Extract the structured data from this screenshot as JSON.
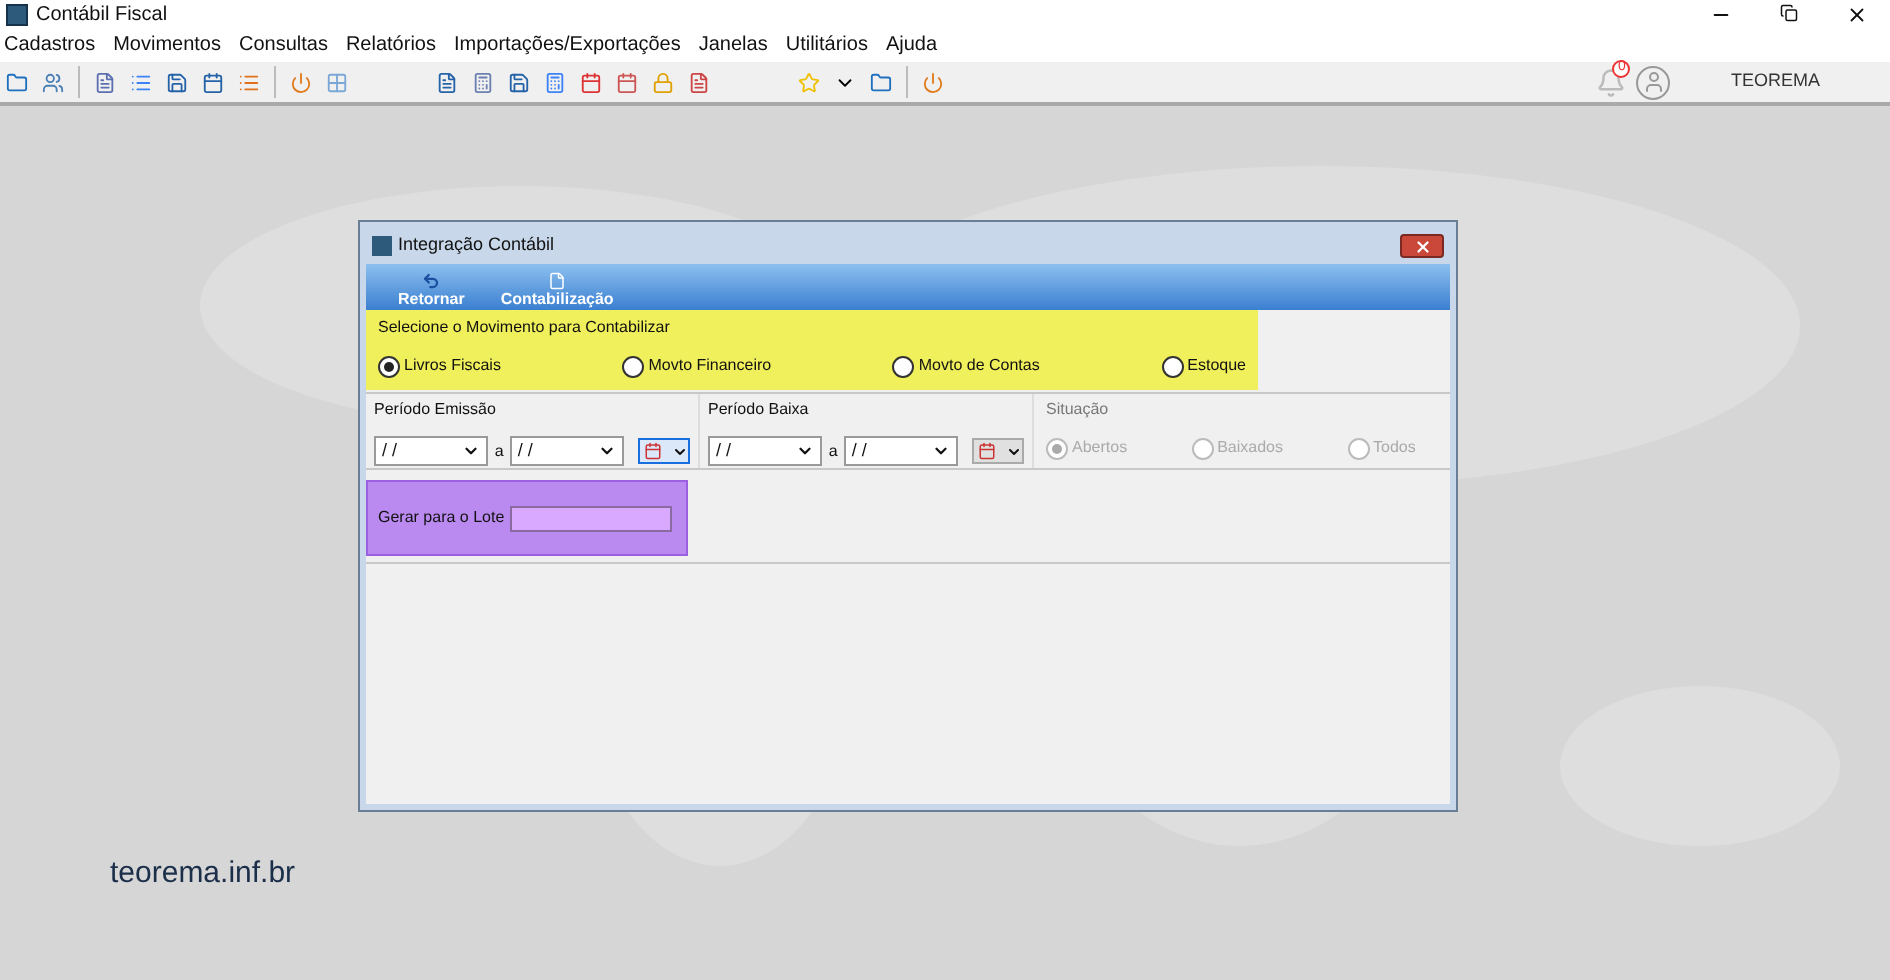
{
  "window": {
    "title": "Contábil Fiscal"
  },
  "menu": [
    "Cadastros",
    "Movimentos",
    "Consultas",
    "Relatórios",
    "Importações/Exportações",
    "Janelas",
    "Utilitários",
    "Ajuda"
  ],
  "user": {
    "notifications": "0",
    "name": "TEOREMA"
  },
  "brand": "teorema.inf.br",
  "dialog": {
    "title": "Integração Contábil",
    "toolbar": [
      {
        "label": "Retornar",
        "kind": "back"
      },
      {
        "label": "Contabilização",
        "kind": "document"
      }
    ],
    "movement": {
      "label": "Selecione o Movimento para Contabilizar",
      "options": [
        {
          "label": "Livros Fiscais",
          "selected": true
        },
        {
          "label": "Movto Financeiro",
          "selected": false
        },
        {
          "label": "Movto de Contas",
          "selected": false
        },
        {
          "label": "Estoque",
          "selected": false
        }
      ]
    },
    "periods": [
      {
        "label": "Período Emissão",
        "from": "/ /",
        "separator": "a",
        "to": "/ /",
        "focused": true
      },
      {
        "label": "Período Baixa",
        "from": "/ /",
        "separator": "a",
        "to": "/ /",
        "focused": false
      }
    ],
    "situation": {
      "label": "Situação",
      "disabled": true,
      "options": [
        {
          "label": "Abertos",
          "selected": true
        },
        {
          "label": "Baixados",
          "selected": false
        },
        {
          "label": "Todos",
          "selected": false
        }
      ]
    },
    "lot": {
      "label": "Gerar para o Lote"
    }
  }
}
